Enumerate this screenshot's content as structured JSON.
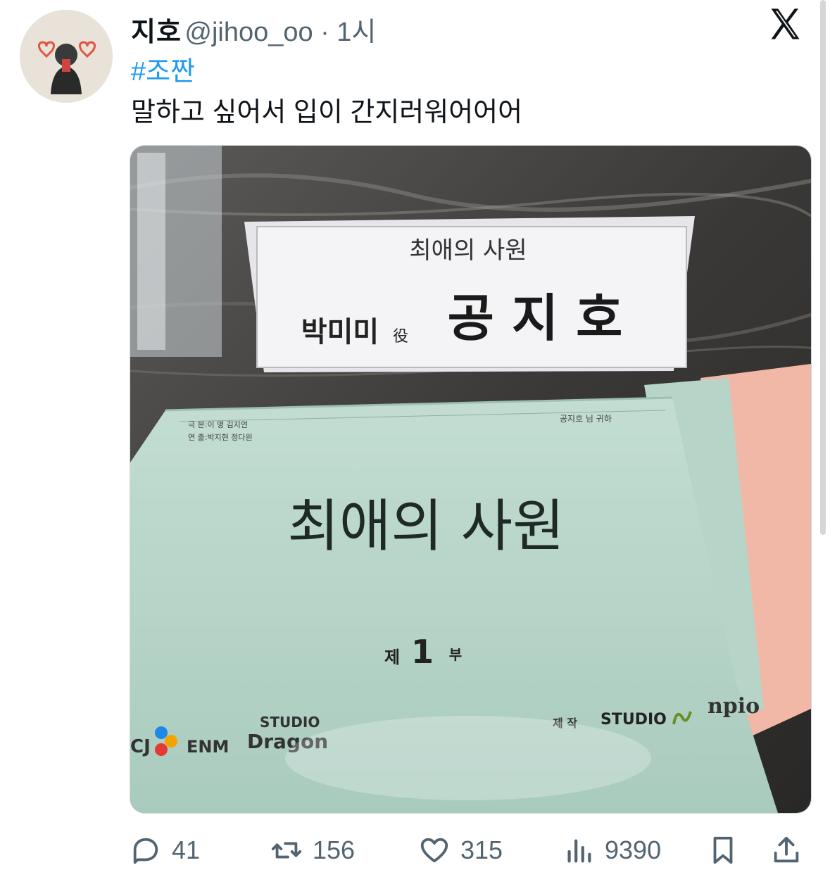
{
  "post": {
    "author_name": "지호",
    "handle": "@jihoo_oo",
    "separator": "·",
    "time": "1시",
    "hashtag": "#조짠",
    "text": "말하고 싶어서 입이 간지러워어어어"
  },
  "media": {
    "nameplate_title": "최애의 사원",
    "nameplate_role_name": "박미미",
    "nameplate_role_suffix": "役",
    "nameplate_actor": "공 지 호",
    "script_header_left_1": "극  본:이 명  김지연",
    "script_header_left_2": "연  출:박지현  정다원",
    "script_header_right": "공지호  님  귀하",
    "script_title": "최애의 사원",
    "episode_prefix": "제",
    "episode_number": "1",
    "episode_suffix": "부",
    "logo_cj": "CJ",
    "logo_enm": "ENM",
    "logo_studio": "STUDIO",
    "logo_dragon": "Dragon",
    "production_label": "제 작",
    "production_studio": "STUDIO",
    "production_pio": "npio"
  },
  "actions": {
    "replies": "41",
    "reposts": "156",
    "likes": "315",
    "views": "9390"
  },
  "colors": {
    "accent": "#1d9bf0",
    "muted": "#536471",
    "script_cover": "#b3d3c6",
    "pink_script": "#f2b8a7"
  }
}
